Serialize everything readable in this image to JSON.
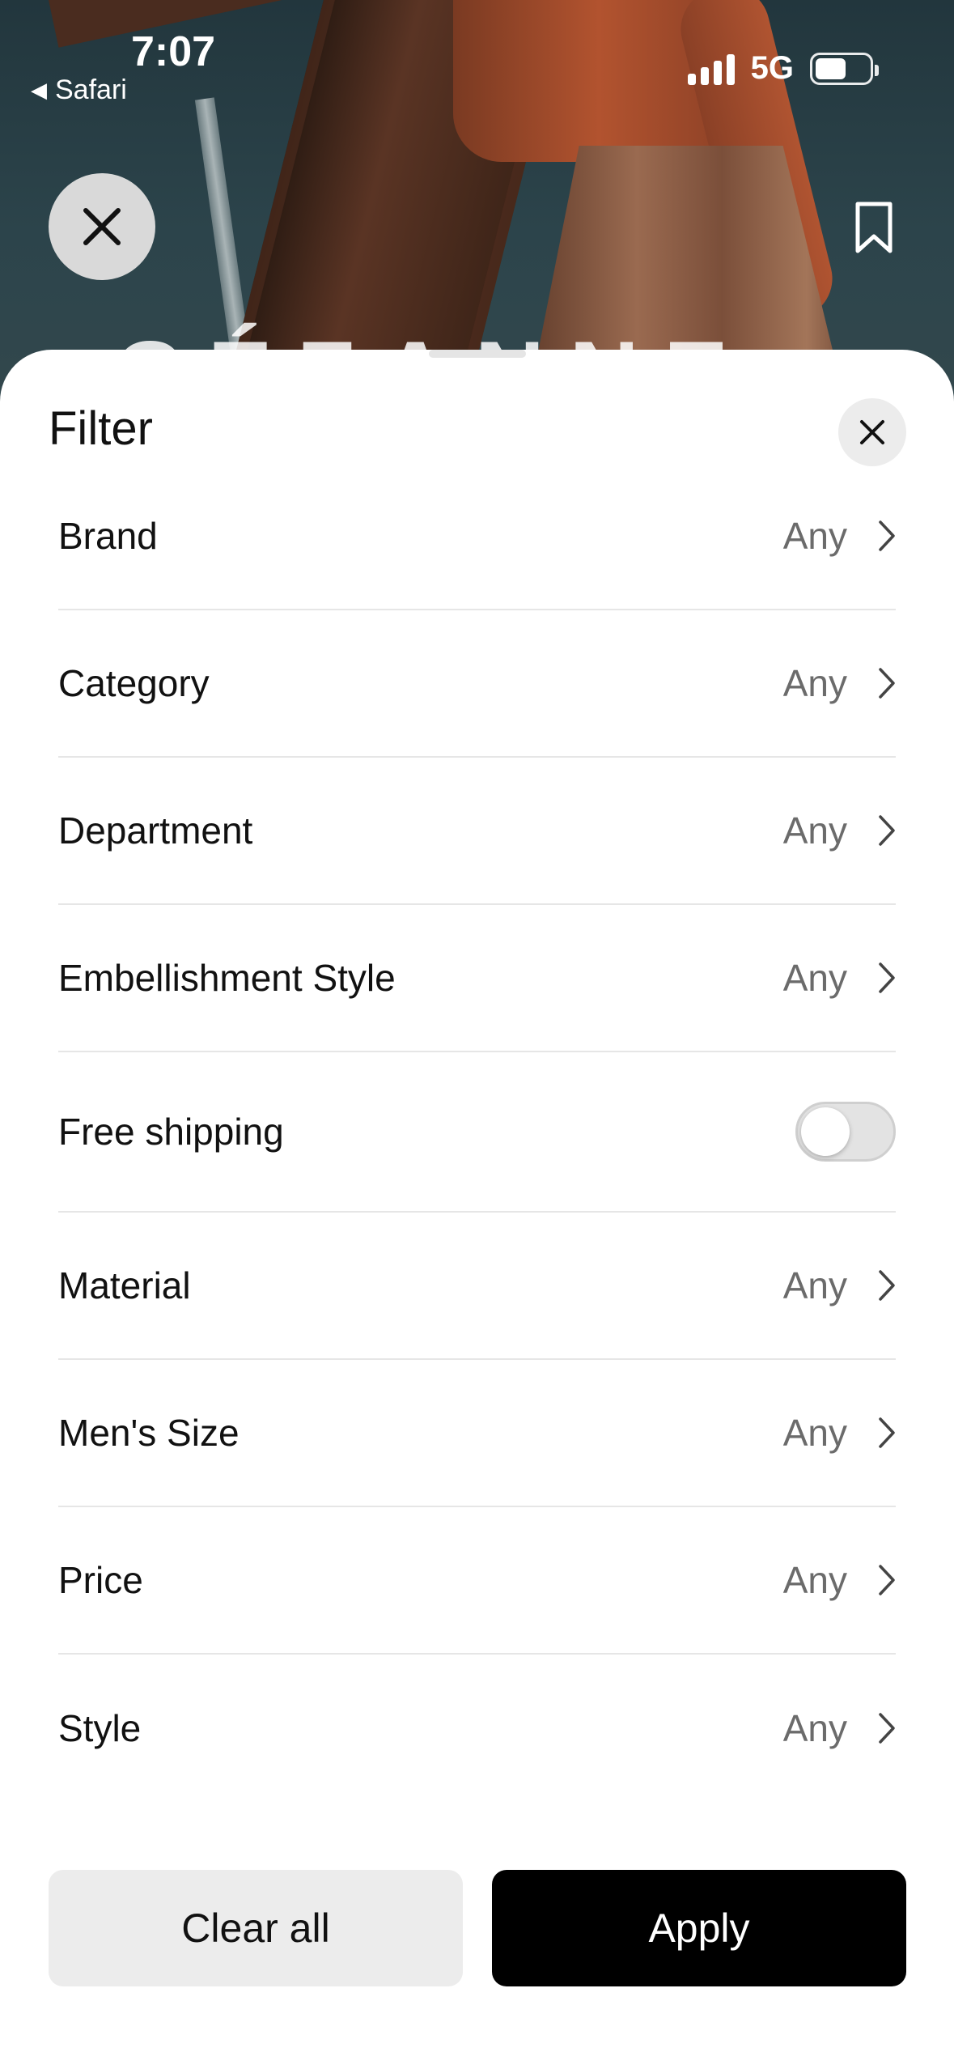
{
  "status_bar": {
    "time": "7:07",
    "back_app": "Safari",
    "network": "5G",
    "back_icon": "triangle-left-icon",
    "signal_icon": "signal-bars-icon",
    "battery_icon": "battery-icon"
  },
  "background": {
    "overlay_text": "CÉZANNE",
    "close_icon": "close-icon",
    "bookmark_icon": "bookmark-icon"
  },
  "sheet": {
    "title": "Filter",
    "close_icon": "close-icon",
    "rows": [
      {
        "label": "Brand",
        "value": "Any",
        "type": "nav"
      },
      {
        "label": "Category",
        "value": "Any",
        "type": "nav"
      },
      {
        "label": "Department",
        "value": "Any",
        "type": "nav"
      },
      {
        "label": "Embellishment Style",
        "value": "Any",
        "type": "nav"
      },
      {
        "label": "Free shipping",
        "type": "toggle",
        "toggle_on": false
      },
      {
        "label": "Material",
        "value": "Any",
        "type": "nav"
      },
      {
        "label": "Men's Size",
        "value": "Any",
        "type": "nav"
      },
      {
        "label": "Price",
        "value": "Any",
        "type": "nav"
      },
      {
        "label": "Style",
        "value": "Any",
        "type": "nav"
      }
    ],
    "clear_label": "Clear all",
    "apply_label": "Apply"
  },
  "colors": {
    "apply_bg": "#000000",
    "clear_bg": "#ececec",
    "value_text": "#6b6b6b",
    "divider": "#e6e6e6"
  }
}
